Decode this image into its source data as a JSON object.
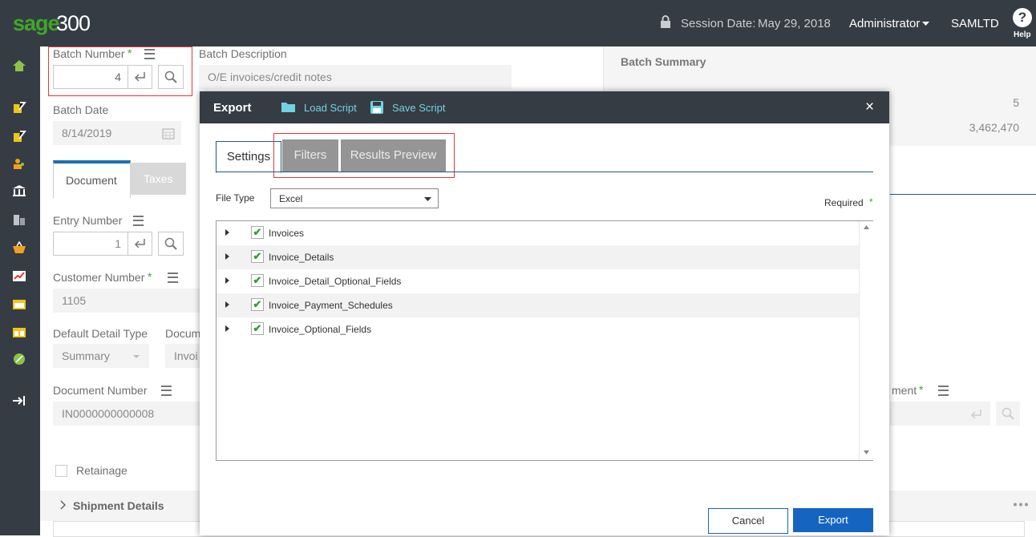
{
  "header": {
    "brand": "sage",
    "brand_num": "300",
    "session_label": "Session Date:",
    "session_date": "May 29, 2018",
    "user": "Administrator",
    "company": "SAMLTD",
    "help_glyph": "?",
    "help_label": "Help"
  },
  "sidebar": {
    "icons": [
      "home-icon",
      "document-edit-icon",
      "document-edit-icon",
      "users-icon",
      "bank-icon",
      "buildings-icon",
      "basket-icon",
      "chart-icon",
      "calendar-icon",
      "calendar-alt-icon",
      "percent-icon",
      "logout-icon"
    ]
  },
  "form": {
    "batch_number_label": "Batch Number",
    "batch_number_value": "4",
    "batch_description_label": "Batch Description",
    "batch_description_value": "O/E invoices/credit notes",
    "batch_summary_label": "Batch Summary",
    "summary_value_1": "5",
    "summary_value_2": "3,462,470",
    "batch_date_label": "Batch Date",
    "batch_date_value": "8/14/2019",
    "tab_document": "Document",
    "tab_taxes": "Taxes",
    "entry_number_label": "Entry Number",
    "entry_number_value": "1",
    "customer_number_label": "Customer Number",
    "customer_number_value": "1105",
    "default_detail_type_label": "Default Detail Type",
    "default_detail_type_value": "Summary",
    "document_type_label": "Docum",
    "document_type_value": "Invoi",
    "document_number_label": "Document Number",
    "document_number_value": "IN0000000000008",
    "right_field_label": "ment",
    "retainage_label": "Retainage",
    "shipment_details_label": "Shipment Details",
    "required_star": "*"
  },
  "modal": {
    "title": "Export",
    "load_script": "Load Script",
    "save_script": "Save Script",
    "close_glyph": "×",
    "tabs": [
      "Settings",
      "Filters",
      "Results Preview"
    ],
    "file_type_label": "File Type",
    "file_type_value": "Excel",
    "required_label": "Required",
    "required_star": "*",
    "tree_items": [
      "Invoices",
      "Invoice_Details",
      "Invoice_Detail_Optional_Fields",
      "Invoice_Payment_Schedules",
      "Invoice_Optional_Fields"
    ],
    "check_glyph": "✔",
    "cancel_label": "Cancel",
    "export_label": "Export"
  },
  "colors": {
    "header_bg": "#363c44",
    "accent_green": "#41a62a",
    "primary_blue": "#1565c0",
    "link_cyan": "#6fd3e4",
    "highlight_red": "#e0393e"
  }
}
